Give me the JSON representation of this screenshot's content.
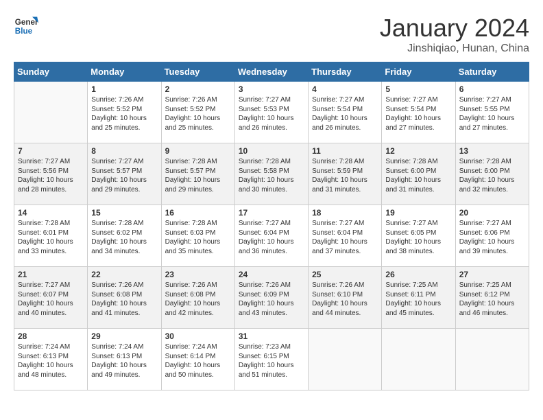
{
  "header": {
    "logo_line1": "General",
    "logo_line2": "Blue",
    "month": "January 2024",
    "location": "Jinshiqiao, Hunan, China"
  },
  "days_of_week": [
    "Sunday",
    "Monday",
    "Tuesday",
    "Wednesday",
    "Thursday",
    "Friday",
    "Saturday"
  ],
  "weeks": [
    [
      {
        "day": "",
        "info": ""
      },
      {
        "day": "1",
        "info": "Sunrise: 7:26 AM\nSunset: 5:52 PM\nDaylight: 10 hours\nand 25 minutes."
      },
      {
        "day": "2",
        "info": "Sunrise: 7:26 AM\nSunset: 5:52 PM\nDaylight: 10 hours\nand 25 minutes."
      },
      {
        "day": "3",
        "info": "Sunrise: 7:27 AM\nSunset: 5:53 PM\nDaylight: 10 hours\nand 26 minutes."
      },
      {
        "day": "4",
        "info": "Sunrise: 7:27 AM\nSunset: 5:54 PM\nDaylight: 10 hours\nand 26 minutes."
      },
      {
        "day": "5",
        "info": "Sunrise: 7:27 AM\nSunset: 5:54 PM\nDaylight: 10 hours\nand 27 minutes."
      },
      {
        "day": "6",
        "info": "Sunrise: 7:27 AM\nSunset: 5:55 PM\nDaylight: 10 hours\nand 27 minutes."
      }
    ],
    [
      {
        "day": "7",
        "info": "Sunrise: 7:27 AM\nSunset: 5:56 PM\nDaylight: 10 hours\nand 28 minutes."
      },
      {
        "day": "8",
        "info": "Sunrise: 7:27 AM\nSunset: 5:57 PM\nDaylight: 10 hours\nand 29 minutes."
      },
      {
        "day": "9",
        "info": "Sunrise: 7:28 AM\nSunset: 5:57 PM\nDaylight: 10 hours\nand 29 minutes."
      },
      {
        "day": "10",
        "info": "Sunrise: 7:28 AM\nSunset: 5:58 PM\nDaylight: 10 hours\nand 30 minutes."
      },
      {
        "day": "11",
        "info": "Sunrise: 7:28 AM\nSunset: 5:59 PM\nDaylight: 10 hours\nand 31 minutes."
      },
      {
        "day": "12",
        "info": "Sunrise: 7:28 AM\nSunset: 6:00 PM\nDaylight: 10 hours\nand 31 minutes."
      },
      {
        "day": "13",
        "info": "Sunrise: 7:28 AM\nSunset: 6:00 PM\nDaylight: 10 hours\nand 32 minutes."
      }
    ],
    [
      {
        "day": "14",
        "info": "Sunrise: 7:28 AM\nSunset: 6:01 PM\nDaylight: 10 hours\nand 33 minutes."
      },
      {
        "day": "15",
        "info": "Sunrise: 7:28 AM\nSunset: 6:02 PM\nDaylight: 10 hours\nand 34 minutes."
      },
      {
        "day": "16",
        "info": "Sunrise: 7:28 AM\nSunset: 6:03 PM\nDaylight: 10 hours\nand 35 minutes."
      },
      {
        "day": "17",
        "info": "Sunrise: 7:27 AM\nSunset: 6:04 PM\nDaylight: 10 hours\nand 36 minutes."
      },
      {
        "day": "18",
        "info": "Sunrise: 7:27 AM\nSunset: 6:04 PM\nDaylight: 10 hours\nand 37 minutes."
      },
      {
        "day": "19",
        "info": "Sunrise: 7:27 AM\nSunset: 6:05 PM\nDaylight: 10 hours\nand 38 minutes."
      },
      {
        "day": "20",
        "info": "Sunrise: 7:27 AM\nSunset: 6:06 PM\nDaylight: 10 hours\nand 39 minutes."
      }
    ],
    [
      {
        "day": "21",
        "info": "Sunrise: 7:27 AM\nSunset: 6:07 PM\nDaylight: 10 hours\nand 40 minutes."
      },
      {
        "day": "22",
        "info": "Sunrise: 7:26 AM\nSunset: 6:08 PM\nDaylight: 10 hours\nand 41 minutes."
      },
      {
        "day": "23",
        "info": "Sunrise: 7:26 AM\nSunset: 6:08 PM\nDaylight: 10 hours\nand 42 minutes."
      },
      {
        "day": "24",
        "info": "Sunrise: 7:26 AM\nSunset: 6:09 PM\nDaylight: 10 hours\nand 43 minutes."
      },
      {
        "day": "25",
        "info": "Sunrise: 7:26 AM\nSunset: 6:10 PM\nDaylight: 10 hours\nand 44 minutes."
      },
      {
        "day": "26",
        "info": "Sunrise: 7:25 AM\nSunset: 6:11 PM\nDaylight: 10 hours\nand 45 minutes."
      },
      {
        "day": "27",
        "info": "Sunrise: 7:25 AM\nSunset: 6:12 PM\nDaylight: 10 hours\nand 46 minutes."
      }
    ],
    [
      {
        "day": "28",
        "info": "Sunrise: 7:24 AM\nSunset: 6:13 PM\nDaylight: 10 hours\nand 48 minutes."
      },
      {
        "day": "29",
        "info": "Sunrise: 7:24 AM\nSunset: 6:13 PM\nDaylight: 10 hours\nand 49 minutes."
      },
      {
        "day": "30",
        "info": "Sunrise: 7:24 AM\nSunset: 6:14 PM\nDaylight: 10 hours\nand 50 minutes."
      },
      {
        "day": "31",
        "info": "Sunrise: 7:23 AM\nSunset: 6:15 PM\nDaylight: 10 hours\nand 51 minutes."
      },
      {
        "day": "",
        "info": ""
      },
      {
        "day": "",
        "info": ""
      },
      {
        "day": "",
        "info": ""
      }
    ]
  ]
}
